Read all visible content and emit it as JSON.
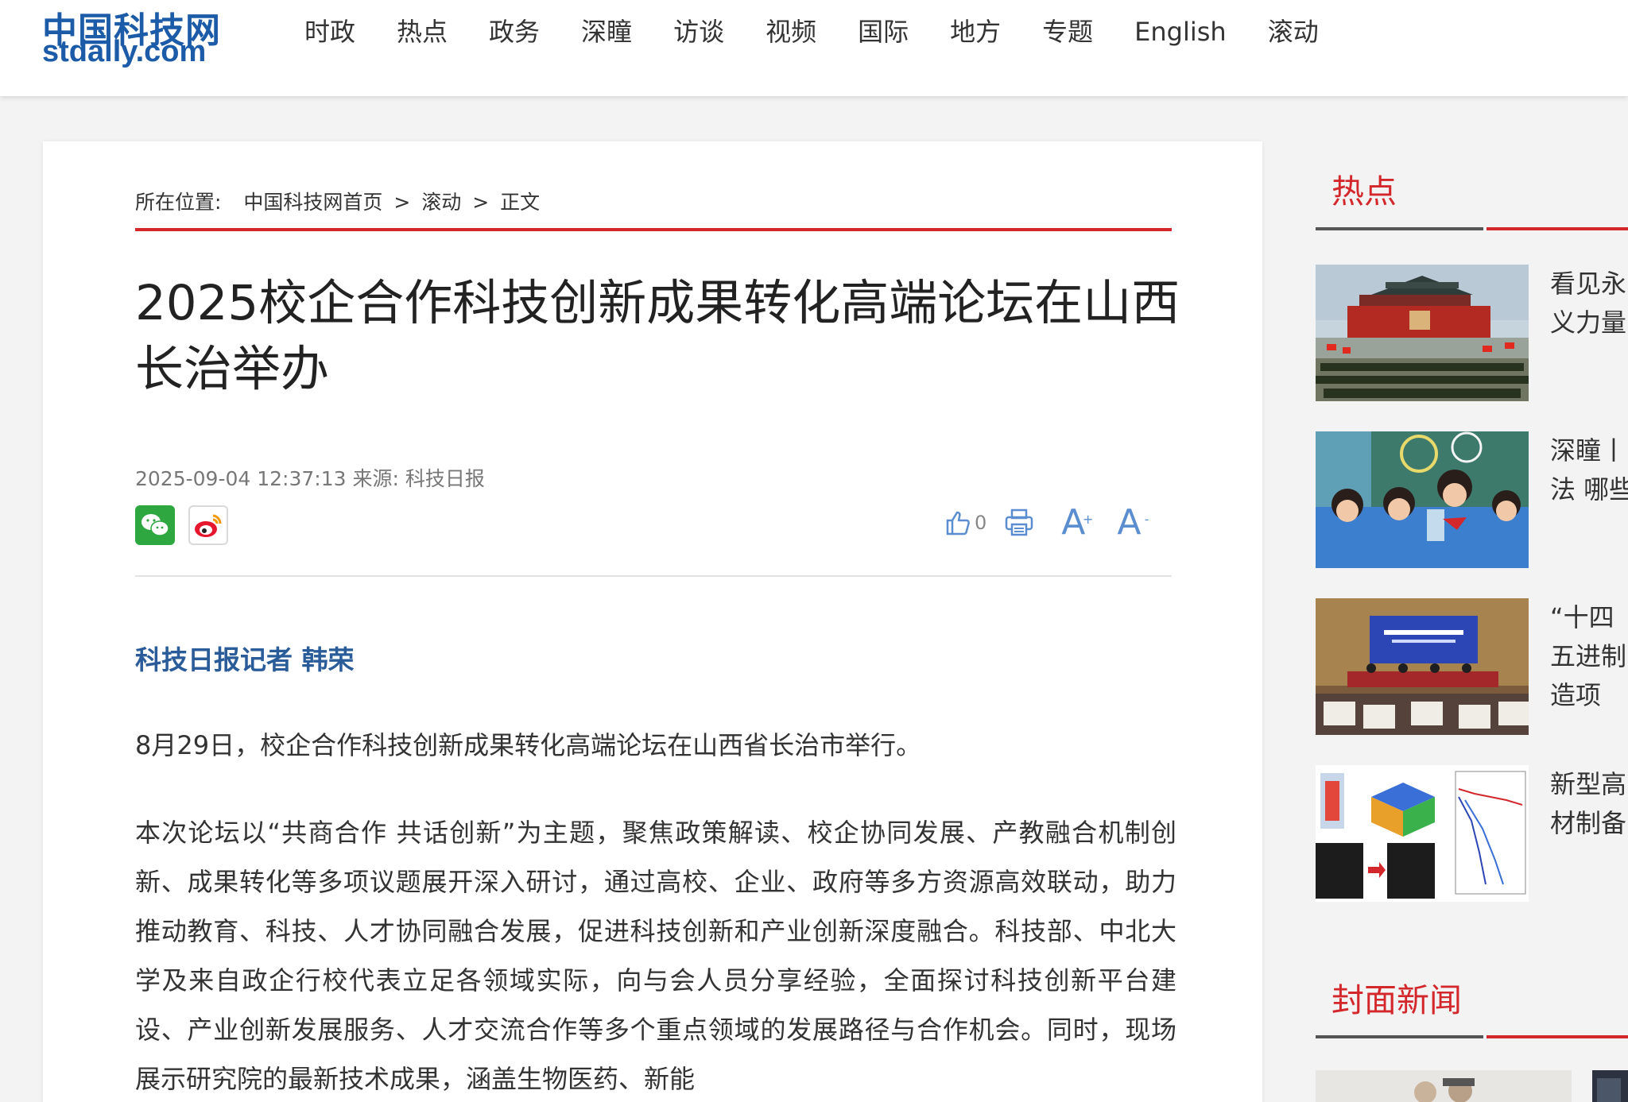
{
  "header": {
    "logo_cn": "中国科技网",
    "logo_en": "stdaily.com",
    "nav": [
      "时政",
      "热点",
      "政务",
      "深瞳",
      "访谈",
      "视频",
      "国际",
      "地方",
      "专题",
      "English",
      "滚动"
    ]
  },
  "breadcrumb": {
    "label": "所在位置:",
    "home": "中国科技网首页",
    "sep1": ">",
    "section": "滚动",
    "sep2": ">",
    "current": "正文"
  },
  "article": {
    "title": "2025校企合作科技创新成果转化高端论坛在山西长治举办",
    "date": "2025-09-04 12:37:13",
    "source_label": "来源:",
    "source": "科技日报",
    "like_count": "0",
    "byline": "科技日报记者 韩荣",
    "para1": "8月29日，校企合作科技创新成果转化高端论坛在山西省长治市举行。",
    "para2": "本次论坛以“共商合作  共话创新”为主题，聚焦政策解读、校企协同发展、产教融合机制创新、成果转化等多项议题展开深入研讨，通过高校、企业、政府等多方资源高效联动，助力推动教育、科技、人才协同融合发展，促进科技创新和产业创新深度融合。科技部、中北大学及来自政企行校代表立足各领域实际，向与会人员分享经验，全面探讨科技创新平台建设、产业创新发展服务、人才交流合作等多个重点领域的发展路径与合作机会。同时，现场展示研究院的最新技术成果，涵盖生物医药、新能"
  },
  "sidebar": {
    "hot_title": "热点",
    "hot_items": [
      {
        "text": "看见永义力量"
      },
      {
        "text": "深瞳丨法 哪些"
      },
      {
        "text": "“十四五进制造项"
      },
      {
        "text": "新型高材制备"
      }
    ],
    "cover_title": "封面新闻"
  },
  "colors": {
    "brand_blue": "#1c5ba7",
    "accent_red": "#d3272b",
    "byline_blue": "#2a5c9a",
    "icon_blue": "#5b8ed0"
  }
}
